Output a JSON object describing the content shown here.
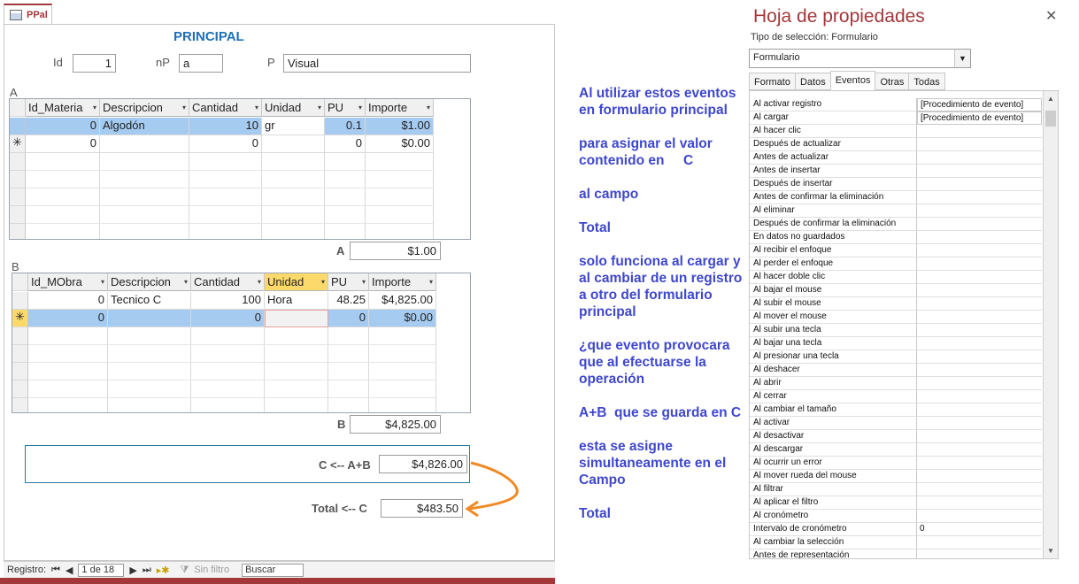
{
  "tab": {
    "label": "PPal"
  },
  "form": {
    "title": "PRINCIPAL",
    "id_label": "Id",
    "id_value": "1",
    "np_label": "nP",
    "np_value": "a",
    "p_label": "P",
    "p_value": "Visual"
  },
  "gridA": {
    "section_label": "A",
    "headers": [
      "Id_Materia",
      "Descripcion",
      "Cantidad",
      "Unidad",
      "PU",
      "Importe"
    ],
    "rows": [
      [
        "0",
        "Algodón",
        "10",
        "gr",
        "0.1",
        "$1.00"
      ]
    ],
    "new_row": [
      "0",
      "",
      "0",
      "",
      "0",
      "$0.00"
    ],
    "total_label": "A",
    "total_value": "$1.00"
  },
  "gridB": {
    "section_label": "B",
    "headers": [
      "Id_MObra",
      "Descripcion",
      "Cantidad",
      "Unidad",
      "PU",
      "Importe"
    ],
    "rows": [
      [
        "0",
        "Tecnico C",
        "100",
        "Hora",
        "48.25",
        "$4,825.00"
      ]
    ],
    "new_row": [
      "0",
      "",
      "0",
      "",
      "0",
      "$0.00"
    ],
    "total_label": "B",
    "total_value": "$4,825.00"
  },
  "calc": {
    "c_label": "C <-- A+B",
    "c_value": "$4,826.00",
    "total_label": "Total <-- C",
    "total_value": "$483.50"
  },
  "statusbar": {
    "registro_label": "Registro:",
    "position": "1 de 18",
    "filter_label": "Sin filtro",
    "search_placeholder": "Buscar"
  },
  "annotation": [
    "Al utilizar estos eventos",
    "en formulario principal",
    "para asignar el valor",
    "contenido en     C",
    "al campo",
    "Total",
    "solo funciona al cargar y",
    "al cambiar de un registro",
    "a otro del formulario",
    "principal",
    "¿que evento provocara",
    "que al efectuarse la",
    "operación",
    "A+B  que se guarda en C",
    "esta se asigne",
    "simultaneamente en el",
    "Campo",
    "Total"
  ],
  "property_sheet": {
    "title": "Hoja de propiedades",
    "selection_label": "Tipo de selección:  Formulario",
    "combo_value": "Formulario",
    "tabs": [
      "Formato",
      "Datos",
      "Eventos",
      "Otras",
      "Todas"
    ],
    "active_tab": "Eventos",
    "properties": [
      [
        "Al activar registro",
        "[Procedimiento de evento]"
      ],
      [
        "Al cargar",
        "[Procedimiento de evento]"
      ],
      [
        "Al hacer clic",
        ""
      ],
      [
        "Después de actualizar",
        ""
      ],
      [
        "Antes de actualizar",
        ""
      ],
      [
        "Antes de insertar",
        ""
      ],
      [
        "Después de insertar",
        ""
      ],
      [
        "Antes de confirmar la eliminación",
        ""
      ],
      [
        "Al eliminar",
        ""
      ],
      [
        "Después de confirmar la eliminación",
        ""
      ],
      [
        "En datos no guardados",
        ""
      ],
      [
        "Al recibir el enfoque",
        ""
      ],
      [
        "Al perder el enfoque",
        ""
      ],
      [
        "Al hacer doble clic",
        ""
      ],
      [
        "Al bajar el mouse",
        ""
      ],
      [
        "Al subir el mouse",
        ""
      ],
      [
        "Al mover el mouse",
        ""
      ],
      [
        "Al subir una tecla",
        ""
      ],
      [
        "Al bajar una tecla",
        ""
      ],
      [
        "Al presionar una tecla",
        ""
      ],
      [
        "Al deshacer",
        ""
      ],
      [
        "Al abrir",
        ""
      ],
      [
        "Al cerrar",
        ""
      ],
      [
        "Al cambiar el tamaño",
        ""
      ],
      [
        "Al activar",
        ""
      ],
      [
        "Al desactivar",
        ""
      ],
      [
        "Al descargar",
        ""
      ],
      [
        "Al ocurrir un error",
        ""
      ],
      [
        "Al mover rueda del mouse",
        ""
      ],
      [
        "Al filtrar",
        ""
      ],
      [
        "Al aplicar el filtro",
        ""
      ],
      [
        "Al cronómetro",
        ""
      ],
      [
        "Intervalo de cronómetro",
        "0"
      ],
      [
        "Al cambiar la selección",
        ""
      ],
      [
        "Antes de representación",
        ""
      ]
    ]
  },
  "colors": {
    "access_red": "#a4373a",
    "annotation_blue": "#3f47cc",
    "arrow_orange": "#f08a24",
    "row_highlight": "#a6cbf0"
  }
}
